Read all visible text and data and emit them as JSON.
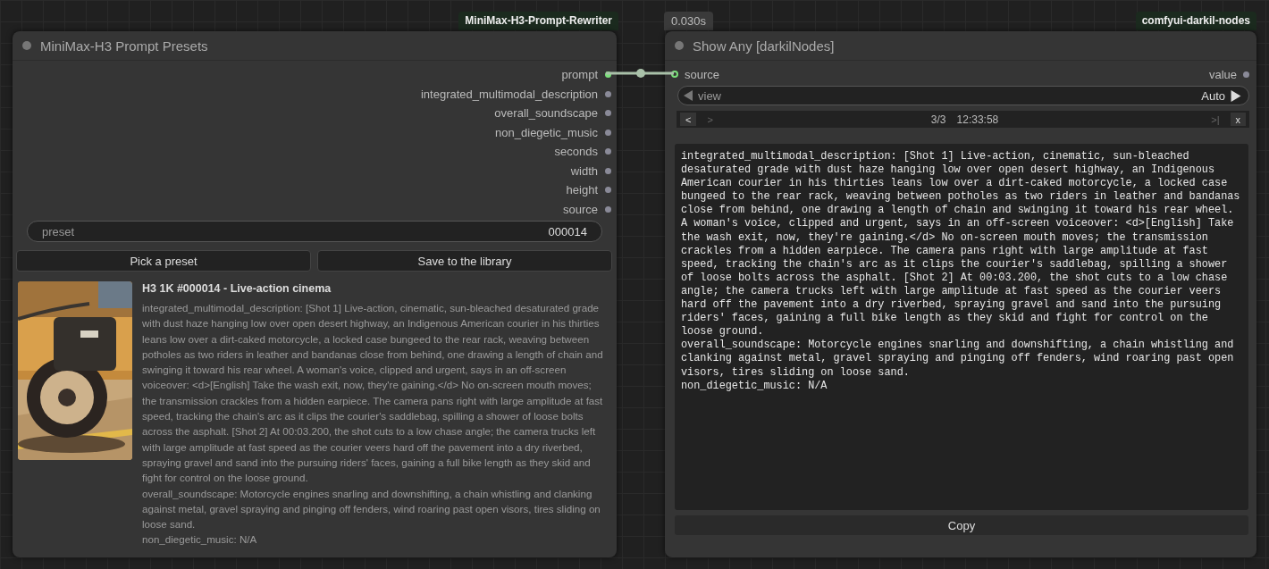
{
  "left_node": {
    "badge": "MiniMax-H3-Prompt-Rewriter",
    "title": "MiniMax-H3 Prompt Presets",
    "outputs": [
      {
        "label": "prompt",
        "connected": true
      },
      {
        "label": "integrated_multimodal_description",
        "connected": false
      },
      {
        "label": "overall_soundscape",
        "connected": false
      },
      {
        "label": "non_diegetic_music",
        "connected": false
      },
      {
        "label": "seconds",
        "connected": false
      },
      {
        "label": "width",
        "connected": false
      },
      {
        "label": "height",
        "connected": false
      },
      {
        "label": "source",
        "connected": false
      }
    ],
    "preset": {
      "label": "preset",
      "value": "000014"
    },
    "buttons": [
      "Pick a preset",
      "Save to the library"
    ],
    "preview": {
      "kind": "picture",
      "title": "H3 1K #000014 - Live-action cinema",
      "paragraphs": [
        "integrated_multimodal_description: [Shot 1] Live-action, cinematic, sun-bleached desaturated grade with dust haze hanging low over open desert highway, an Indigenous American courier in his thirties leans low over a dirt-caked motorcycle, a locked case bungeed to the rear rack, weaving between potholes as two riders in leather and bandanas close from behind, one drawing a length of chain and swinging it toward his rear wheel. A woman's voice, clipped and urgent, says in an off-screen voiceover: <d>[English] Take the wash exit, now, they're gaining.</d> No on-screen mouth moves; the transmission crackles from a hidden earpiece. The camera pans right with large amplitude at fast speed, tracking the chain's arc as it clips the courier's saddlebag, spilling a shower of loose bolts across the asphalt. [Shot 2] At 00:03.200, the shot cuts to a low chase angle; the camera trucks left with large amplitude at fast speed as the courier veers hard off the pavement into a dry riverbed, spraying gravel and sand into the pursuing riders' faces, gaining a full bike length as they skid and fight for control on the loose ground.",
        "overall_soundscape: Motorcycle engines snarling and downshifting, a chain whistling and clanking against metal, gravel spraying and pinging off fenders, wind roaring past open visors, tires sliding on loose sand.",
        "non_diegetic_music: N/A"
      ]
    }
  },
  "right_node": {
    "timing": "0.030s",
    "badge": "comfyui-darkil-nodes",
    "title": "Show Any [darkilNodes]",
    "input": {
      "label": "source",
      "connected": true
    },
    "output": {
      "label": "value",
      "connected": false
    },
    "view": {
      "label": "view",
      "value": "Auto"
    },
    "pager": {
      "buttons": [
        {
          "label": "<",
          "disabled": false
        },
        {
          "label": ">",
          "disabled": true
        }
      ],
      "position": "3/3",
      "time": "12:33:58",
      "end_buttons": [
        {
          "label": ">|",
          "disabled": true
        },
        {
          "label": "x",
          "disabled": false
        }
      ]
    },
    "text": [
      "integrated_multimodal_description: [Shot 1] Live-action, cinematic, sun-bleached desaturated grade with dust haze hanging low over open desert highway, an Indigenous American courier in his thirties leans low over a dirt-caked motorcycle, a locked case bungeed to the rear rack, weaving between potholes as two riders in leather and bandanas close from behind, one drawing a length of chain and swinging it toward his rear wheel. A woman's voice, clipped and urgent, says in an off-screen voiceover: <d>[English] Take the wash exit, now, they're gaining.</d> No on-screen mouth moves; the transmission crackles from a hidden earpiece. The camera pans right with large amplitude at fast speed, tracking the chain's arc as it clips the courier's saddlebag, spilling a shower of loose bolts across the asphalt. [Shot 2] At 00:03.200, the shot cuts to a low chase angle; the camera trucks left with large amplitude at fast speed as the courier veers hard off the pavement into a dry riverbed, spraying gravel and sand into the pursuing riders' faces, gaining a full bike length as they skid and fight for control on the loose ground.",
      "overall_soundscape: Motorcycle engines snarling and downshifting, a chain whistling and clanking against metal, gravel spraying and pinging off fenders, wind roaring past open visors, tires sliding on loose sand.",
      "non_diegetic_music: N/A"
    ],
    "copy": "Copy"
  }
}
